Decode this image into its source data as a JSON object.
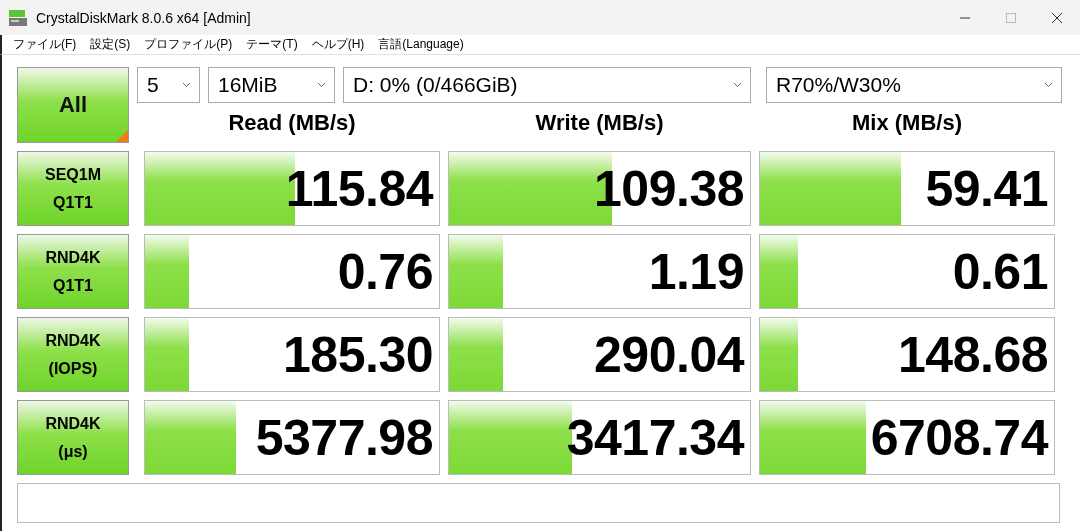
{
  "window": {
    "title": "CrystalDiskMark 8.0.6 x64 [Admin]"
  },
  "menu": [
    "ファイル(F)",
    "設定(S)",
    "プロファイル(P)",
    "テーマ(T)",
    "ヘルプ(H)",
    "言語(Language)"
  ],
  "all_button": {
    "label": "All"
  },
  "selectors": {
    "count": "5",
    "size": "16MiB",
    "drive": "D: 0% (0/466GiB)",
    "mix": "R70%/W30%"
  },
  "columns": [
    "Read (MB/s)",
    "Write (MB/s)",
    "Mix (MB/s)"
  ],
  "rows": [
    {
      "label": [
        "SEQ1M",
        "Q1T1"
      ],
      "results": [
        {
          "value": "115.84",
          "level": 0.51
        },
        {
          "value": "109.38",
          "level": 0.54
        },
        {
          "value": "59.41",
          "level": 0.48
        }
      ]
    },
    {
      "label": [
        "RND4K",
        "Q1T1"
      ],
      "results": [
        {
          "value": "0.76",
          "level": 0.15
        },
        {
          "value": "1.19",
          "level": 0.18
        },
        {
          "value": "0.61",
          "level": 0.13
        }
      ]
    },
    {
      "label": [
        "RND4K",
        "(IOPS)"
      ],
      "results": [
        {
          "value": "185.30",
          "level": 0.15
        },
        {
          "value": "290.04",
          "level": 0.18
        },
        {
          "value": "148.68",
          "level": 0.13
        }
      ]
    },
    {
      "label": [
        "RND4K",
        "(μs)"
      ],
      "results": [
        {
          "value": "5377.98",
          "level": 0.31
        },
        {
          "value": "3417.34",
          "level": 0.41
        },
        {
          "value": "6708.74",
          "level": 0.36
        }
      ]
    }
  ]
}
